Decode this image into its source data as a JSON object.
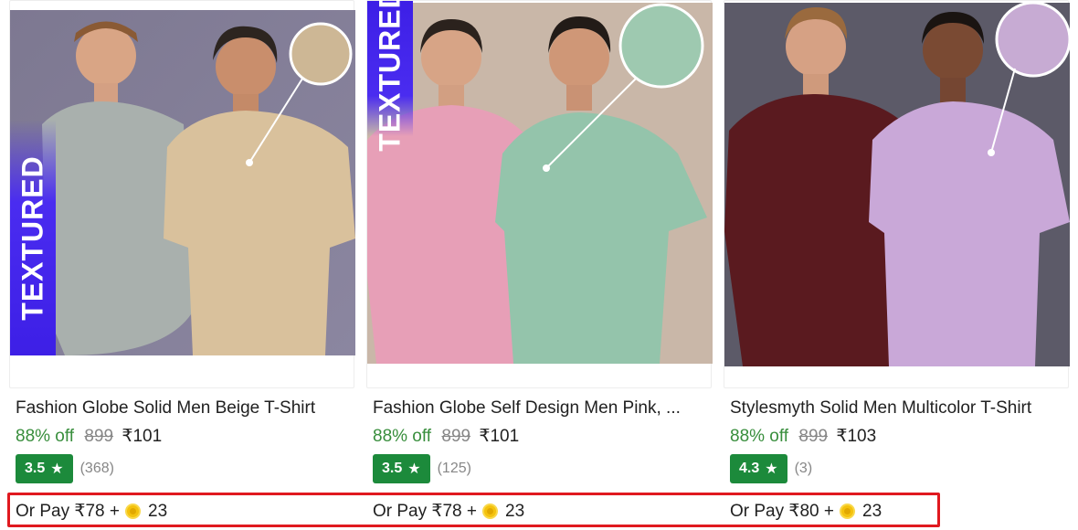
{
  "products": [
    {
      "badge": "TEXTURED",
      "title": "Fashion Globe Solid Men Beige T-Shirt",
      "discount": "88% off",
      "mrp": "899",
      "price": "₹101",
      "rating": "3.5",
      "reviews": "(368)",
      "pay_text": "Or Pay ₹78 +",
      "coins": "23"
    },
    {
      "badge": "TEXTURED",
      "title": "Fashion Globe Self Design Men Pink, ...",
      "discount": "88% off",
      "mrp": "899",
      "price": "₹101",
      "rating": "3.5",
      "reviews": "(125)",
      "pay_text": "Or Pay ₹78 +",
      "coins": "23"
    },
    {
      "title": "Stylesmyth Solid Men Multicolor T-Shirt",
      "discount": "88% off",
      "mrp": "899",
      "price": "₹103",
      "rating": "4.3",
      "reviews": "(3)",
      "pay_text": "Or Pay ₹80 +",
      "coins": "23"
    }
  ],
  "colors": {
    "discount_green": "#388e3c",
    "rating_badge": "#1c8a3b",
    "highlight_red": "#e0191f",
    "coin": "#f4c20d",
    "textured_badge": "#3d1fe6"
  },
  "icons": {
    "rating": "star-icon",
    "coin": "supercoin-icon"
  }
}
